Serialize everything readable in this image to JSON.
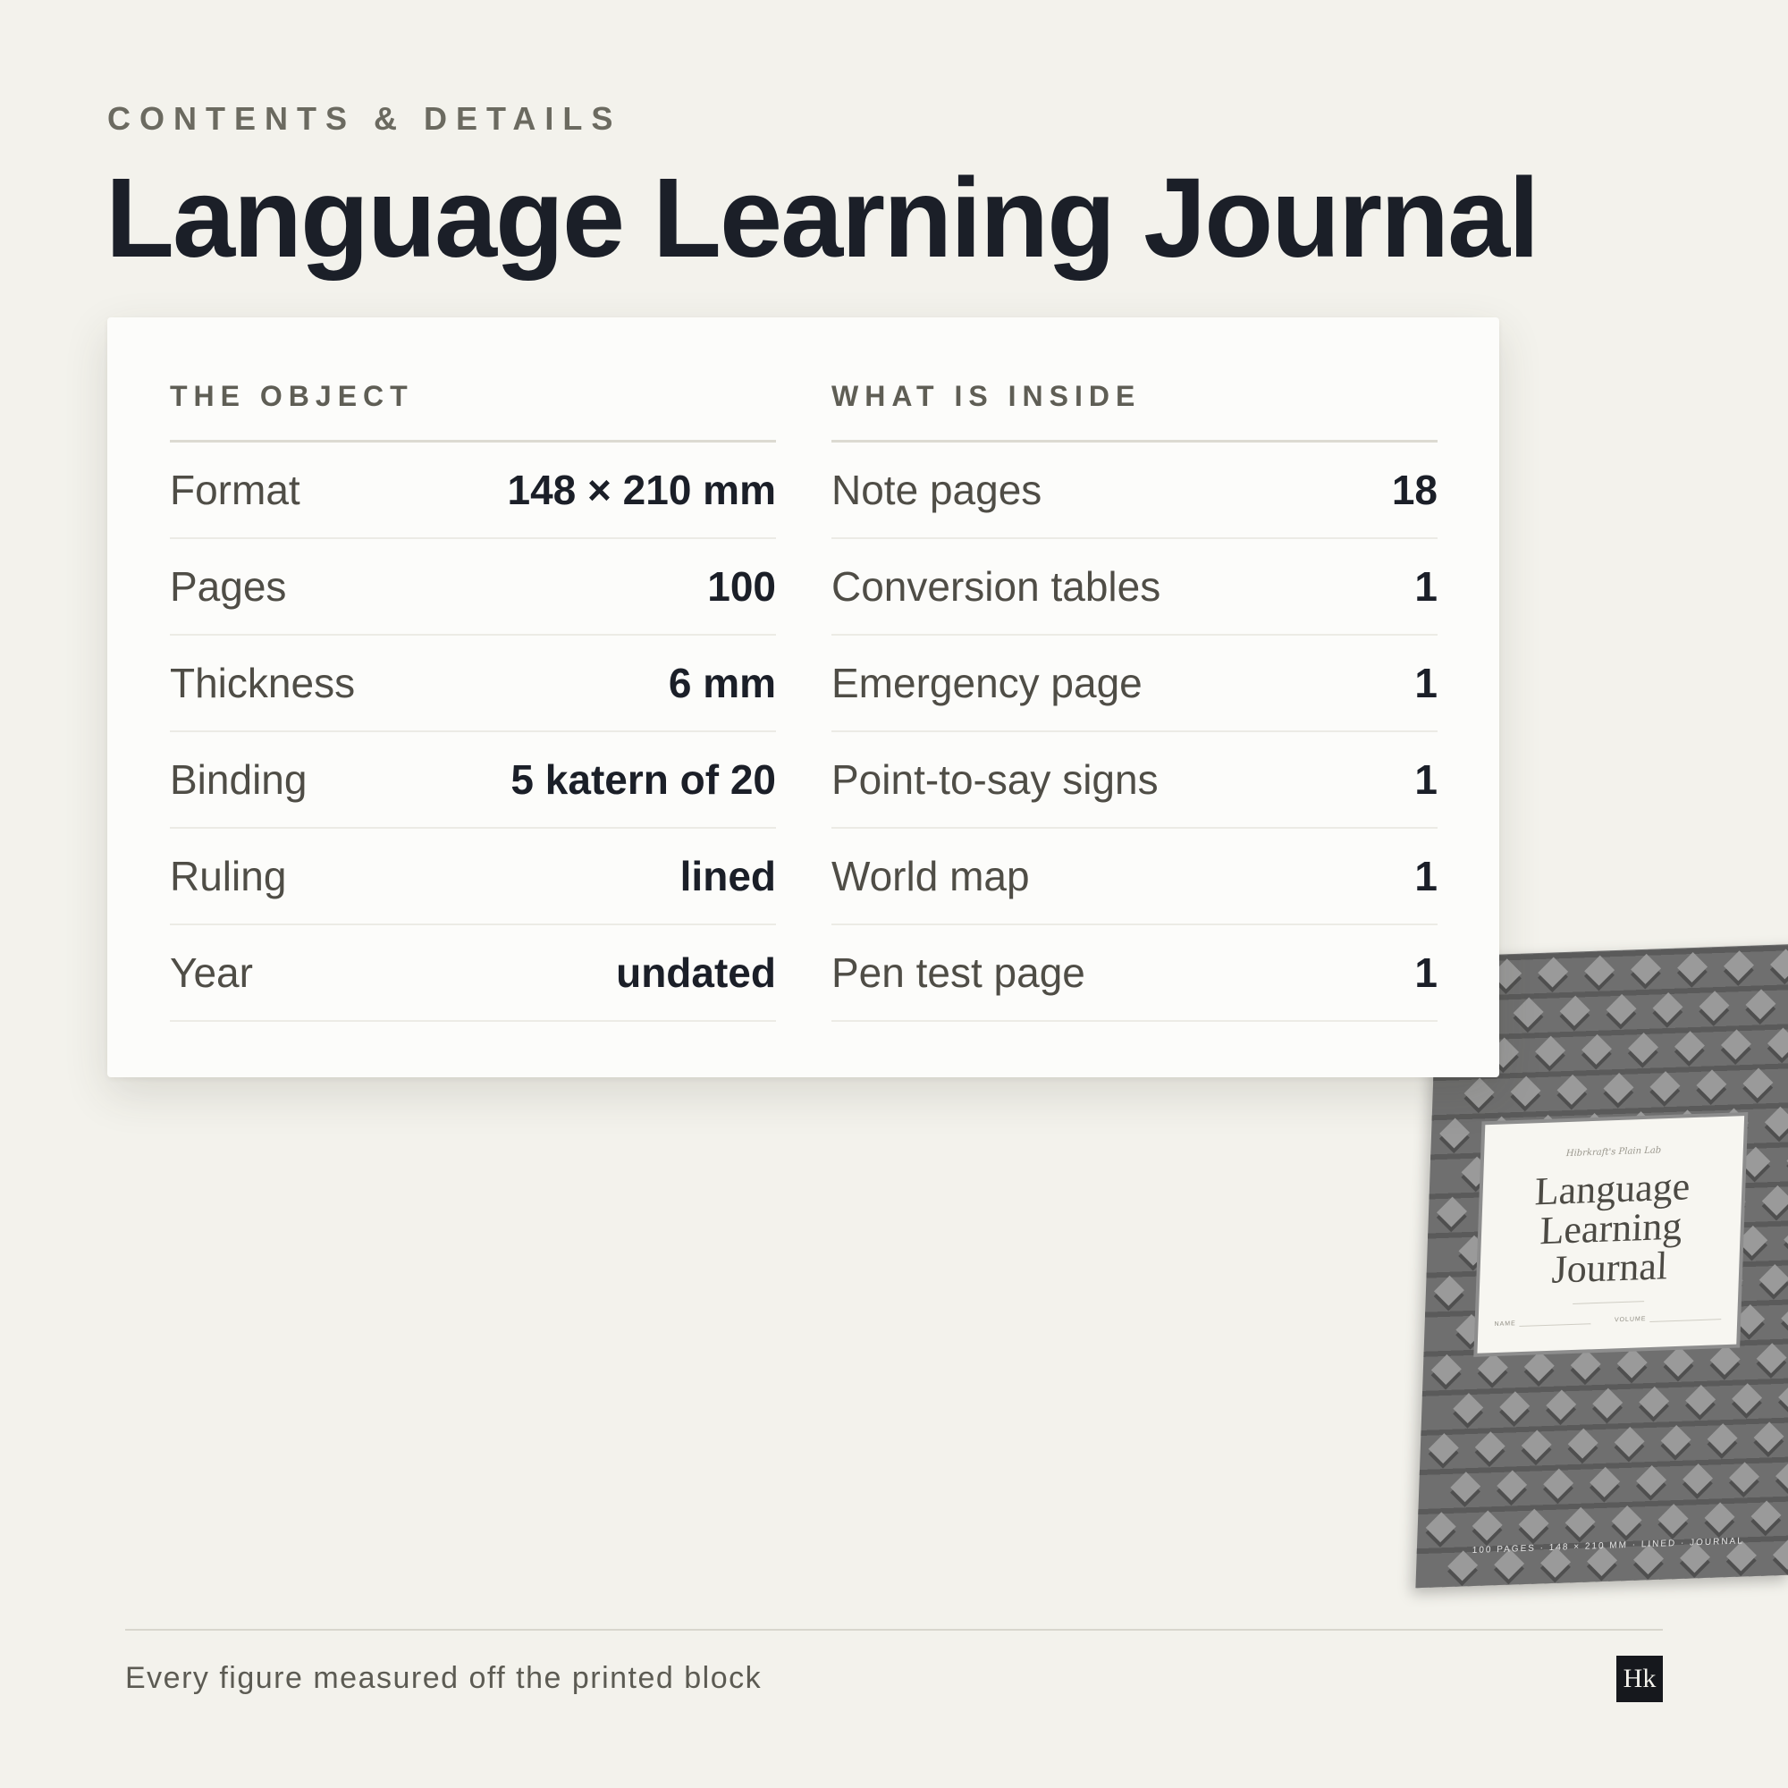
{
  "header": {
    "eyebrow": "CONTENTS & DETAILS",
    "title": "Language Learning Journal"
  },
  "card": {
    "object": {
      "heading": "THE OBJECT",
      "rows": [
        {
          "label": "Format",
          "value": "148 × 210 mm"
        },
        {
          "label": "Pages",
          "value": "100"
        },
        {
          "label": "Thickness",
          "value": "6 mm"
        },
        {
          "label": "Binding",
          "value": "5 katern of 20"
        },
        {
          "label": "Ruling",
          "value": "lined"
        },
        {
          "label": "Year",
          "value": "undated"
        }
      ]
    },
    "inside": {
      "heading": "WHAT IS INSIDE",
      "rows": [
        {
          "label": "Note pages",
          "value": "18"
        },
        {
          "label": "Conversion tables",
          "value": "1"
        },
        {
          "label": "Emergency page",
          "value": "1"
        },
        {
          "label": "Point-to-say signs",
          "value": "1"
        },
        {
          "label": "World map",
          "value": "1"
        },
        {
          "label": "Pen test page",
          "value": "1"
        }
      ]
    }
  },
  "book": {
    "brand": "Hibrkraft's Plain Lab",
    "title_lines": [
      "Language",
      "Learning",
      "Journal"
    ],
    "field_name": "NAME",
    "field_volume": "VOLUME",
    "footer": "100 PAGES · 148 × 210 MM · LINED · JOURNAL"
  },
  "footer": {
    "note": "Every figure measured off the printed block",
    "logo": "Hk"
  },
  "colors": {
    "background": "#f3f2ec",
    "title": "#1b1f28",
    "card": "#fcfcfa",
    "book_cover": "#6f6f6f"
  }
}
